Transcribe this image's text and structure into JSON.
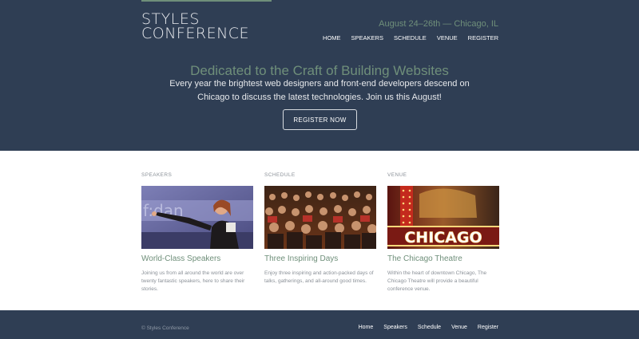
{
  "header": {
    "logo_line1": "STYLES",
    "logo_line2": "CONFERENCE",
    "dates": "August 24–26th — Chicago, IL",
    "nav": [
      "HOME",
      "SPEAKERS",
      "SCHEDULE",
      "VENUE",
      "REGISTER"
    ]
  },
  "hero": {
    "headline": "Dedicated to the Craft of Building Websites",
    "subtext": "Every year the brightest web designers and front-end developers descend on Chicago to discuss the latest technologies. Join us this August!",
    "cta": "REGISTER NOW"
  },
  "sections": [
    {
      "label": "SPEAKERS",
      "title": "World-Class Speakers",
      "text": "Joining us from all around the world are over twenty fantastic speakers, here to share their stories."
    },
    {
      "label": "SCHEDULE",
      "title": "Three Inspiring Days",
      "text": "Enjoy three inspiring and action-packed days of talks, gatherings, and all-around good times."
    },
    {
      "label": "VENUE",
      "title": "The Chicago Theatre",
      "text": "Within the heart of downtown Chicago, The Chicago Theatre will provide a beautiful conference venue.",
      "sign_text": "CHICAGO"
    }
  ],
  "footer": {
    "copyright": "© Styles Conference",
    "nav": [
      "Home",
      "Speakers",
      "Schedule",
      "Venue",
      "Register"
    ]
  },
  "colors": {
    "primary_dark": "#2f3e54",
    "accent_green": "#6f8f7a",
    "muted_text": "#8b9198"
  }
}
